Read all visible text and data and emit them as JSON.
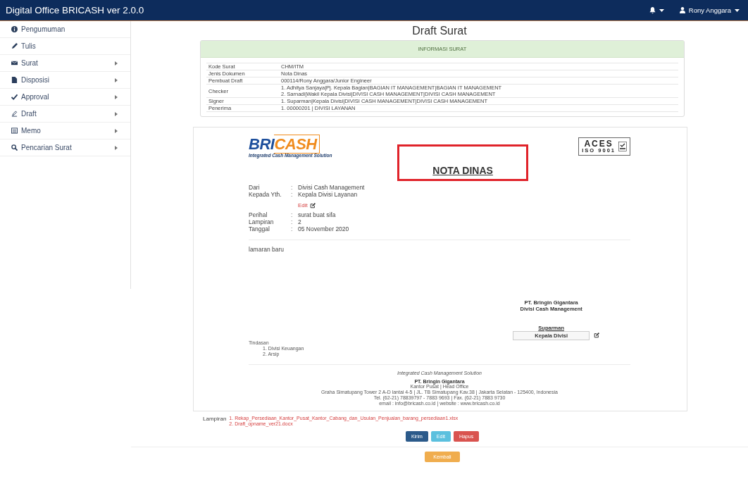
{
  "navbar": {
    "brand": "Digital Office BRICASH ver 2.0.0",
    "user": "Rony Anggara"
  },
  "sidebar": {
    "items": [
      {
        "label": "Pengumuman",
        "has_submenu": false
      },
      {
        "label": "Tulis",
        "has_submenu": false
      },
      {
        "label": "Surat",
        "has_submenu": true
      },
      {
        "label": "Disposisi",
        "has_submenu": true
      },
      {
        "label": "Approval",
        "has_submenu": true
      },
      {
        "label": "Draft",
        "has_submenu": true
      },
      {
        "label": "Memo",
        "has_submenu": true
      },
      {
        "label": "Pencarian Surat",
        "has_submenu": true
      }
    ]
  },
  "page_title": "Draft Surat",
  "info_panel": {
    "heading": "INFORMASI SURAT",
    "rows": [
      {
        "label": "Kode Surat",
        "values": [
          "CHM/ITM"
        ]
      },
      {
        "label": "Jenis Dokumen",
        "values": [
          "Nota Dinas"
        ]
      },
      {
        "label": "Pembuat Draft",
        "values": [
          "000114/Rony Anggara/Junior Engineer"
        ]
      },
      {
        "label": "Checker",
        "values": [
          "1. Adhitya Sanjaya|Pj. Kepala Bagian|BAGIAN IT MANAGEMENT|BAGIAN IT MANAGEMENT",
          "2. Sarnadi|Wakil Kepala Divisi|DIVISI CASH MANAGEMENT|DIVISI CASH MANAGEMENT"
        ]
      },
      {
        "label": "Signer",
        "values": [
          "1. Suparman|Kepala Divisi|DIVISI CASH MANAGEMENT|DIVISI CASH MANAGEMENT"
        ]
      },
      {
        "label": "Penerima",
        "values": [
          "1. 00000201 | DIVISI LAYANAN"
        ]
      }
    ]
  },
  "document": {
    "logo": {
      "part_1": "BRI",
      "part_2": "CASH",
      "tagline": "Integrated Cash Management Solution"
    },
    "certification": {
      "mark": "ACES",
      "standard": "ISO 9001"
    },
    "title": "NOTA DINAS",
    "header_fields": [
      {
        "label": "Dari",
        "value": "Divisi Cash Management"
      },
      {
        "label": "Kepada Yth.",
        "value": "Kepala Divisi Layanan"
      }
    ],
    "separator": ":",
    "edit_link": "Edit",
    "detail_fields": [
      {
        "label": "Perihal",
        "value": "surat buat sifa"
      },
      {
        "label": "Lampiran",
        "value": "2"
      },
      {
        "label": "Tanggal",
        "value": "05 November 2020"
      }
    ],
    "body": "lamaran baru",
    "signature": {
      "company": "PT. Bringin Gigantara",
      "division": "Divisi Cash Management",
      "name": "Suparman",
      "position": "Kepala Divisi"
    },
    "copies": {
      "label": "Tindasan",
      "items": [
        "1. Divisi Keuangan",
        "2. Arsip"
      ]
    },
    "footer": {
      "tagline": "Integrated Cash Management Solution",
      "company": "PT. Bringin Gigantara",
      "lines": [
        "Kantor Pusat | Head Office",
        "Graha Simatupang Tower 2 A-D lantai 4-5 | JL. TB Simatupang Kav.38 | Jakarta Selatan - 125400, Indonesia",
        "Tel. (62-21) 78839797 - 7883 9693 | Fax. (62-21) 7883 9730",
        "email : info@bricash.co.id | website : www.bricash.co.id"
      ]
    }
  },
  "attachments": {
    "label": "Lampiran",
    "files": [
      "1. Rekap_Persediaan_Kantor_Pusat_Kantor_Cabang_dan_Usulan_Penjualan_barang_persediaan1.xlsx",
      "2. Draft_opname_ver21.docx"
    ]
  },
  "actions": [
    {
      "label": "Kirim",
      "kind": "primary"
    },
    {
      "label": "Edit",
      "kind": "info"
    },
    {
      "label": "Hapus",
      "kind": "danger"
    }
  ],
  "back_button": {
    "label": "Kembali"
  }
}
